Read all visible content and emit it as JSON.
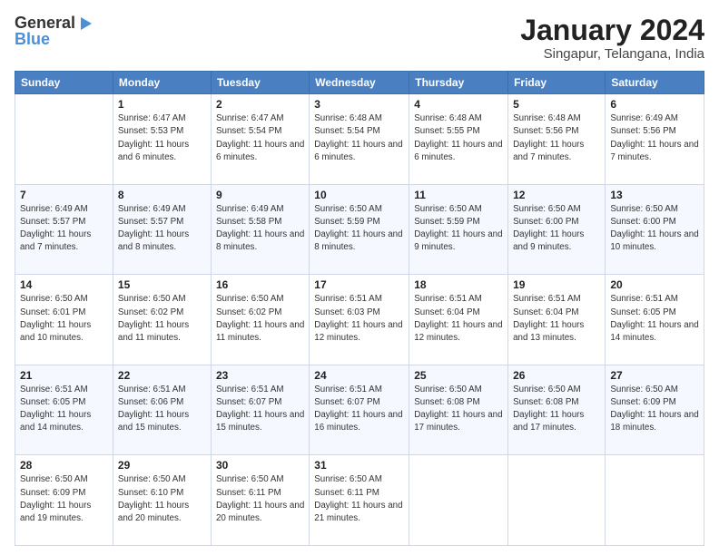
{
  "header": {
    "logo_general": "General",
    "logo_blue": "Blue",
    "title": "January 2024",
    "subtitle": "Singapur, Telangana, India"
  },
  "weekdays": [
    "Sunday",
    "Monday",
    "Tuesday",
    "Wednesday",
    "Thursday",
    "Friday",
    "Saturday"
  ],
  "weeks": [
    [
      {
        "day": "",
        "info": ""
      },
      {
        "day": "1",
        "info": "Sunrise: 6:47 AM\nSunset: 5:53 PM\nDaylight: 11 hours and 6 minutes."
      },
      {
        "day": "2",
        "info": "Sunrise: 6:47 AM\nSunset: 5:54 PM\nDaylight: 11 hours and 6 minutes."
      },
      {
        "day": "3",
        "info": "Sunrise: 6:48 AM\nSunset: 5:54 PM\nDaylight: 11 hours and 6 minutes."
      },
      {
        "day": "4",
        "info": "Sunrise: 6:48 AM\nSunset: 5:55 PM\nDaylight: 11 hours and 6 minutes."
      },
      {
        "day": "5",
        "info": "Sunrise: 6:48 AM\nSunset: 5:56 PM\nDaylight: 11 hours and 7 minutes."
      },
      {
        "day": "6",
        "info": "Sunrise: 6:49 AM\nSunset: 5:56 PM\nDaylight: 11 hours and 7 minutes."
      }
    ],
    [
      {
        "day": "7",
        "info": "Sunrise: 6:49 AM\nSunset: 5:57 PM\nDaylight: 11 hours and 7 minutes."
      },
      {
        "day": "8",
        "info": "Sunrise: 6:49 AM\nSunset: 5:57 PM\nDaylight: 11 hours and 8 minutes."
      },
      {
        "day": "9",
        "info": "Sunrise: 6:49 AM\nSunset: 5:58 PM\nDaylight: 11 hours and 8 minutes."
      },
      {
        "day": "10",
        "info": "Sunrise: 6:50 AM\nSunset: 5:59 PM\nDaylight: 11 hours and 8 minutes."
      },
      {
        "day": "11",
        "info": "Sunrise: 6:50 AM\nSunset: 5:59 PM\nDaylight: 11 hours and 9 minutes."
      },
      {
        "day": "12",
        "info": "Sunrise: 6:50 AM\nSunset: 6:00 PM\nDaylight: 11 hours and 9 minutes."
      },
      {
        "day": "13",
        "info": "Sunrise: 6:50 AM\nSunset: 6:00 PM\nDaylight: 11 hours and 10 minutes."
      }
    ],
    [
      {
        "day": "14",
        "info": "Sunrise: 6:50 AM\nSunset: 6:01 PM\nDaylight: 11 hours and 10 minutes."
      },
      {
        "day": "15",
        "info": "Sunrise: 6:50 AM\nSunset: 6:02 PM\nDaylight: 11 hours and 11 minutes."
      },
      {
        "day": "16",
        "info": "Sunrise: 6:50 AM\nSunset: 6:02 PM\nDaylight: 11 hours and 11 minutes."
      },
      {
        "day": "17",
        "info": "Sunrise: 6:51 AM\nSunset: 6:03 PM\nDaylight: 11 hours and 12 minutes."
      },
      {
        "day": "18",
        "info": "Sunrise: 6:51 AM\nSunset: 6:04 PM\nDaylight: 11 hours and 12 minutes."
      },
      {
        "day": "19",
        "info": "Sunrise: 6:51 AM\nSunset: 6:04 PM\nDaylight: 11 hours and 13 minutes."
      },
      {
        "day": "20",
        "info": "Sunrise: 6:51 AM\nSunset: 6:05 PM\nDaylight: 11 hours and 14 minutes."
      }
    ],
    [
      {
        "day": "21",
        "info": "Sunrise: 6:51 AM\nSunset: 6:05 PM\nDaylight: 11 hours and 14 minutes."
      },
      {
        "day": "22",
        "info": "Sunrise: 6:51 AM\nSunset: 6:06 PM\nDaylight: 11 hours and 15 minutes."
      },
      {
        "day": "23",
        "info": "Sunrise: 6:51 AM\nSunset: 6:07 PM\nDaylight: 11 hours and 15 minutes."
      },
      {
        "day": "24",
        "info": "Sunrise: 6:51 AM\nSunset: 6:07 PM\nDaylight: 11 hours and 16 minutes."
      },
      {
        "day": "25",
        "info": "Sunrise: 6:50 AM\nSunset: 6:08 PM\nDaylight: 11 hours and 17 minutes."
      },
      {
        "day": "26",
        "info": "Sunrise: 6:50 AM\nSunset: 6:08 PM\nDaylight: 11 hours and 17 minutes."
      },
      {
        "day": "27",
        "info": "Sunrise: 6:50 AM\nSunset: 6:09 PM\nDaylight: 11 hours and 18 minutes."
      }
    ],
    [
      {
        "day": "28",
        "info": "Sunrise: 6:50 AM\nSunset: 6:09 PM\nDaylight: 11 hours and 19 minutes."
      },
      {
        "day": "29",
        "info": "Sunrise: 6:50 AM\nSunset: 6:10 PM\nDaylight: 11 hours and 20 minutes."
      },
      {
        "day": "30",
        "info": "Sunrise: 6:50 AM\nSunset: 6:11 PM\nDaylight: 11 hours and 20 minutes."
      },
      {
        "day": "31",
        "info": "Sunrise: 6:50 AM\nSunset: 6:11 PM\nDaylight: 11 hours and 21 minutes."
      },
      {
        "day": "",
        "info": ""
      },
      {
        "day": "",
        "info": ""
      },
      {
        "day": "",
        "info": ""
      }
    ]
  ]
}
